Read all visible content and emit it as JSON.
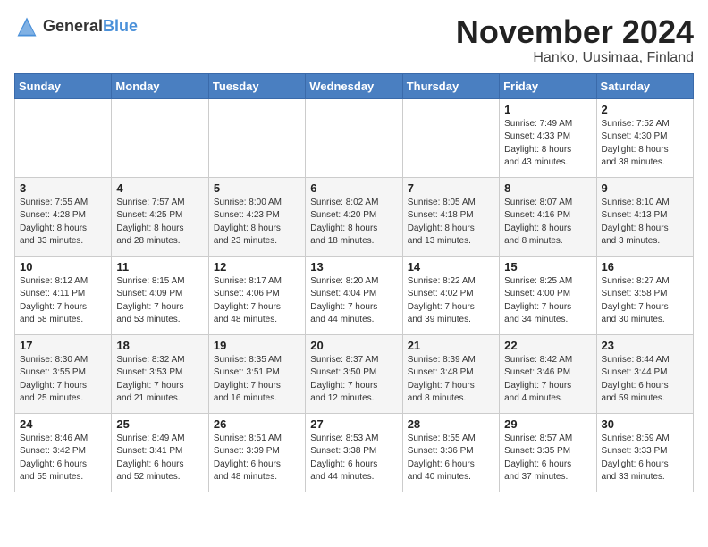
{
  "logo": {
    "general": "General",
    "blue": "Blue"
  },
  "title": {
    "month": "November 2024",
    "location": "Hanko, Uusimaa, Finland"
  },
  "headers": [
    "Sunday",
    "Monday",
    "Tuesday",
    "Wednesday",
    "Thursday",
    "Friday",
    "Saturday"
  ],
  "weeks": [
    [
      {
        "day": "",
        "info": ""
      },
      {
        "day": "",
        "info": ""
      },
      {
        "day": "",
        "info": ""
      },
      {
        "day": "",
        "info": ""
      },
      {
        "day": "",
        "info": ""
      },
      {
        "day": "1",
        "info": "Sunrise: 7:49 AM\nSunset: 4:33 PM\nDaylight: 8 hours\nand 43 minutes."
      },
      {
        "day": "2",
        "info": "Sunrise: 7:52 AM\nSunset: 4:30 PM\nDaylight: 8 hours\nand 38 minutes."
      }
    ],
    [
      {
        "day": "3",
        "info": "Sunrise: 7:55 AM\nSunset: 4:28 PM\nDaylight: 8 hours\nand 33 minutes."
      },
      {
        "day": "4",
        "info": "Sunrise: 7:57 AM\nSunset: 4:25 PM\nDaylight: 8 hours\nand 28 minutes."
      },
      {
        "day": "5",
        "info": "Sunrise: 8:00 AM\nSunset: 4:23 PM\nDaylight: 8 hours\nand 23 minutes."
      },
      {
        "day": "6",
        "info": "Sunrise: 8:02 AM\nSunset: 4:20 PM\nDaylight: 8 hours\nand 18 minutes."
      },
      {
        "day": "7",
        "info": "Sunrise: 8:05 AM\nSunset: 4:18 PM\nDaylight: 8 hours\nand 13 minutes."
      },
      {
        "day": "8",
        "info": "Sunrise: 8:07 AM\nSunset: 4:16 PM\nDaylight: 8 hours\nand 8 minutes."
      },
      {
        "day": "9",
        "info": "Sunrise: 8:10 AM\nSunset: 4:13 PM\nDaylight: 8 hours\nand 3 minutes."
      }
    ],
    [
      {
        "day": "10",
        "info": "Sunrise: 8:12 AM\nSunset: 4:11 PM\nDaylight: 7 hours\nand 58 minutes."
      },
      {
        "day": "11",
        "info": "Sunrise: 8:15 AM\nSunset: 4:09 PM\nDaylight: 7 hours\nand 53 minutes."
      },
      {
        "day": "12",
        "info": "Sunrise: 8:17 AM\nSunset: 4:06 PM\nDaylight: 7 hours\nand 48 minutes."
      },
      {
        "day": "13",
        "info": "Sunrise: 8:20 AM\nSunset: 4:04 PM\nDaylight: 7 hours\nand 44 minutes."
      },
      {
        "day": "14",
        "info": "Sunrise: 8:22 AM\nSunset: 4:02 PM\nDaylight: 7 hours\nand 39 minutes."
      },
      {
        "day": "15",
        "info": "Sunrise: 8:25 AM\nSunset: 4:00 PM\nDaylight: 7 hours\nand 34 minutes."
      },
      {
        "day": "16",
        "info": "Sunrise: 8:27 AM\nSunset: 3:58 PM\nDaylight: 7 hours\nand 30 minutes."
      }
    ],
    [
      {
        "day": "17",
        "info": "Sunrise: 8:30 AM\nSunset: 3:55 PM\nDaylight: 7 hours\nand 25 minutes."
      },
      {
        "day": "18",
        "info": "Sunrise: 8:32 AM\nSunset: 3:53 PM\nDaylight: 7 hours\nand 21 minutes."
      },
      {
        "day": "19",
        "info": "Sunrise: 8:35 AM\nSunset: 3:51 PM\nDaylight: 7 hours\nand 16 minutes."
      },
      {
        "day": "20",
        "info": "Sunrise: 8:37 AM\nSunset: 3:50 PM\nDaylight: 7 hours\nand 12 minutes."
      },
      {
        "day": "21",
        "info": "Sunrise: 8:39 AM\nSunset: 3:48 PM\nDaylight: 7 hours\nand 8 minutes."
      },
      {
        "day": "22",
        "info": "Sunrise: 8:42 AM\nSunset: 3:46 PM\nDaylight: 7 hours\nand 4 minutes."
      },
      {
        "day": "23",
        "info": "Sunrise: 8:44 AM\nSunset: 3:44 PM\nDaylight: 6 hours\nand 59 minutes."
      }
    ],
    [
      {
        "day": "24",
        "info": "Sunrise: 8:46 AM\nSunset: 3:42 PM\nDaylight: 6 hours\nand 55 minutes."
      },
      {
        "day": "25",
        "info": "Sunrise: 8:49 AM\nSunset: 3:41 PM\nDaylight: 6 hours\nand 52 minutes."
      },
      {
        "day": "26",
        "info": "Sunrise: 8:51 AM\nSunset: 3:39 PM\nDaylight: 6 hours\nand 48 minutes."
      },
      {
        "day": "27",
        "info": "Sunrise: 8:53 AM\nSunset: 3:38 PM\nDaylight: 6 hours\nand 44 minutes."
      },
      {
        "day": "28",
        "info": "Sunrise: 8:55 AM\nSunset: 3:36 PM\nDaylight: 6 hours\nand 40 minutes."
      },
      {
        "day": "29",
        "info": "Sunrise: 8:57 AM\nSunset: 3:35 PM\nDaylight: 6 hours\nand 37 minutes."
      },
      {
        "day": "30",
        "info": "Sunrise: 8:59 AM\nSunset: 3:33 PM\nDaylight: 6 hours\nand 33 minutes."
      }
    ]
  ]
}
